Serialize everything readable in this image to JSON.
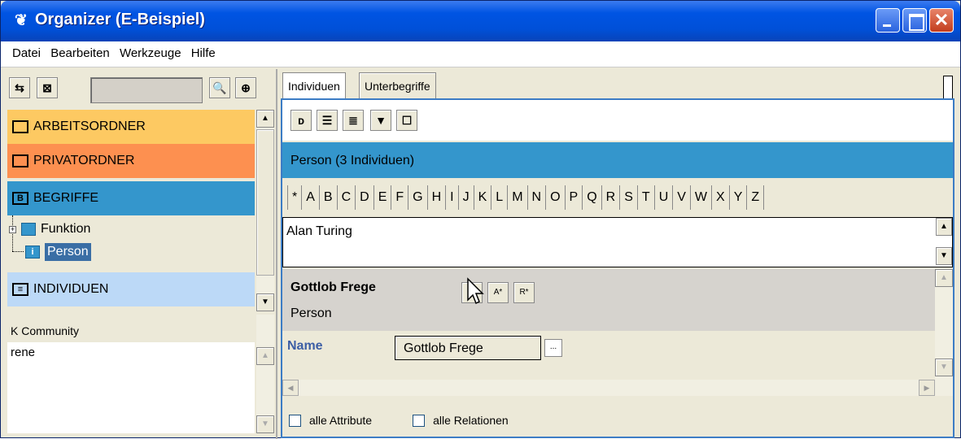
{
  "window": {
    "title": "Organizer (E-Beispiel)",
    "app_icon": "organizer-icon"
  },
  "menu": {
    "items": [
      "Datei",
      "Bearbeiten",
      "Werkzeuge",
      "Hilfe"
    ]
  },
  "left": {
    "folders": {
      "arbeit": "ARBEITSORDNER",
      "privat": "PRIVATORDNER",
      "begriffe": "BEGRIFFE",
      "individuen": "INDIVIDUEN"
    },
    "tree": {
      "funktion": "Funktion",
      "person": "Person"
    },
    "community": {
      "header": "K Community",
      "user": "rene"
    }
  },
  "right": {
    "tabs": [
      "Individuen",
      "Unterbegriffe"
    ],
    "header": "Person (3 Individuen)",
    "letters": [
      "*",
      "A",
      "B",
      "C",
      "D",
      "E",
      "F",
      "G",
      "H",
      "I",
      "J",
      "K",
      "L",
      "M",
      "N",
      "O",
      "P",
      "Q",
      "R",
      "S",
      "T",
      "U",
      "V",
      "W",
      "X",
      "Y",
      "Z"
    ],
    "list_item": "Alan Turing",
    "detail": {
      "name": "Gottlob Frege",
      "class": "Person",
      "buttons": [
        "B*",
        "A*",
        "R*"
      ]
    },
    "attribute": {
      "label": "Name",
      "value": "Gottlob Frege",
      "more": "..."
    },
    "checkbox_attrs": "alle Attribute",
    "checkbox_rels": "alle Relationen"
  }
}
